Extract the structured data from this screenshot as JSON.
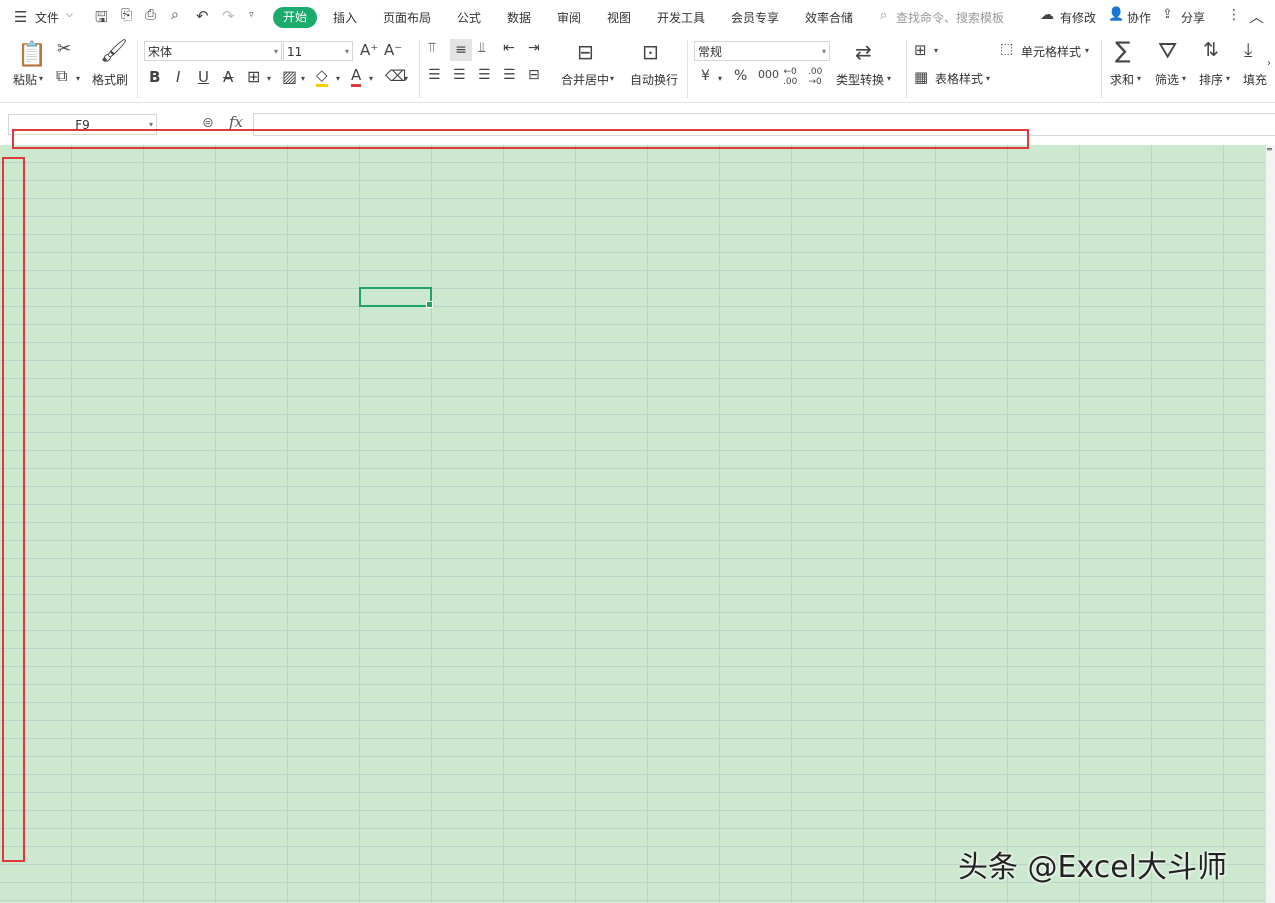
{
  "menubar": {
    "file": "文件",
    "tabs": [
      "开始",
      "插入",
      "页面布局",
      "公式",
      "数据",
      "审阅",
      "视图",
      "开发工具",
      "会员专享",
      "效率合储"
    ],
    "search_placeholder": "查找命令、搜索模板",
    "right": [
      "有修改",
      "协作",
      "分享"
    ]
  },
  "ribbon": {
    "paste": "粘贴",
    "format_painter": "格式刷",
    "font_name": "宋体",
    "font_size": "11",
    "merge_center": "合并居中",
    "wrap_text": "自动换行",
    "number_format": "常规",
    "type_convert": "类型转换",
    "cell_style": "单元格样式",
    "table_style": "表格样式",
    "sum": "求和",
    "filter": "筛选",
    "sort": "排序",
    "fill": "填充"
  },
  "formula_bar": {
    "name_box": "F9",
    "fx": "fx",
    "value": ""
  },
  "watermark": "头条 @Excel大斗师"
}
